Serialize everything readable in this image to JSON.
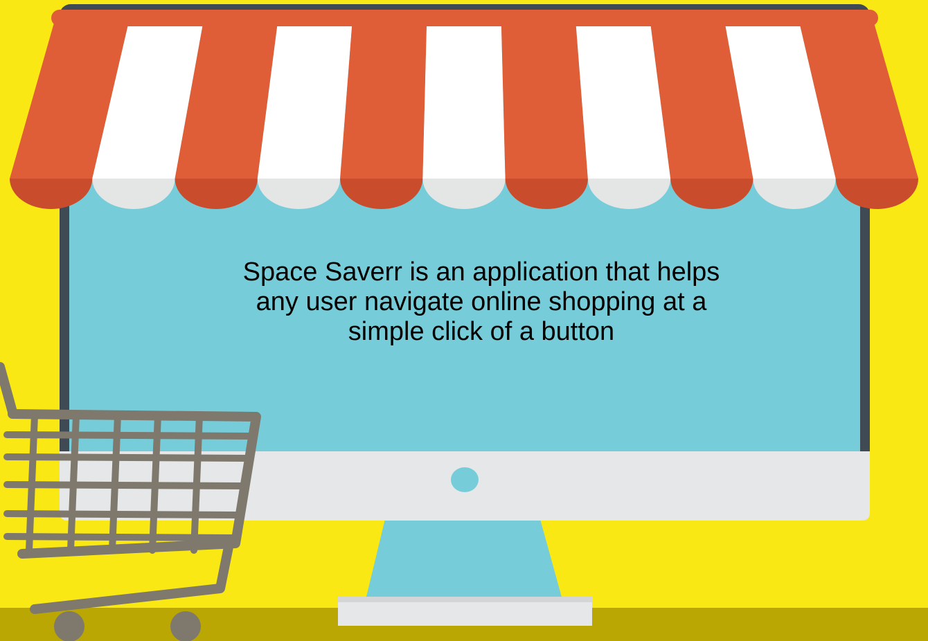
{
  "description": "Space Saverr is an application that helps any user navigate online shopping at a simple click of a button",
  "icons": [
    "shop-awning-icon",
    "desktop-monitor-icon",
    "shopping-cart-icon"
  ],
  "colors": {
    "background": "#f9e814",
    "floor": "#bba704",
    "awning_red": "#df5e38",
    "awning_white": "#ffffff",
    "screen": "#76cdd9",
    "monitor_frame": "#e6e7e8",
    "bezel": "#3f4a54",
    "cart": "#7e786d"
  }
}
